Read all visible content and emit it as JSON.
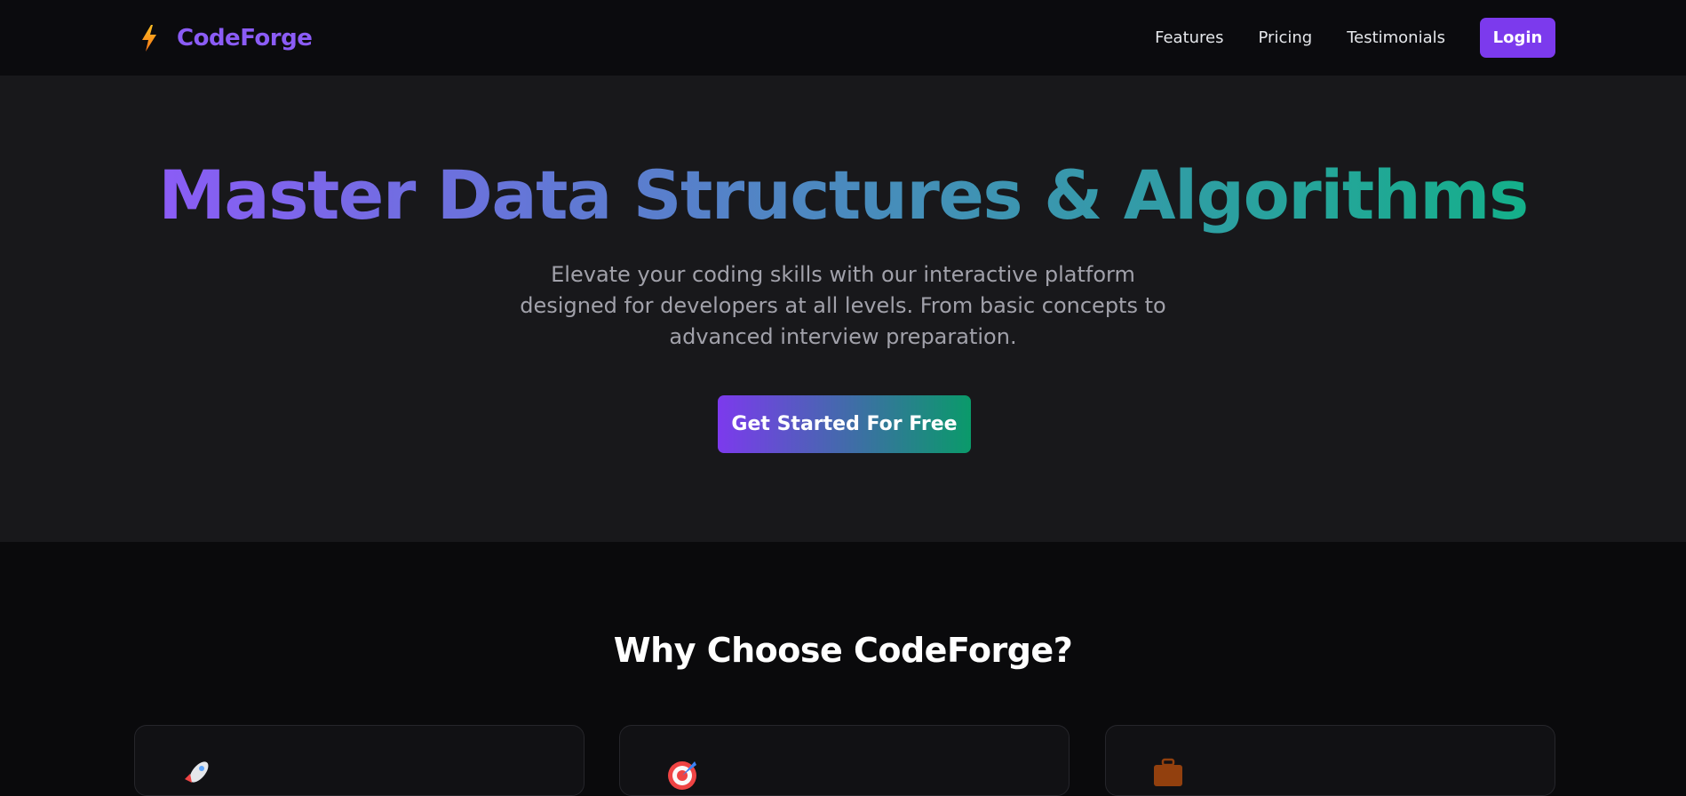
{
  "brand": {
    "name": "CodeForge",
    "icon": "lightning-bolt-icon",
    "color": "#8b5cf6"
  },
  "nav": {
    "links": [
      "Features",
      "Pricing",
      "Testimonials"
    ],
    "login_label": "Login"
  },
  "hero": {
    "title": "Master Data Structures & Algorithms",
    "subtitle": "Elevate your coding skills with our interactive platform designed for developers at all levels. From basic concepts to advanced interview preparation.",
    "cta_label": "Get Started For Free"
  },
  "features": {
    "title": "Why Choose CodeForge?",
    "cards": [
      {
        "icon": "rocket-icon"
      },
      {
        "icon": "target-icon"
      },
      {
        "icon": "briefcase-icon"
      }
    ]
  },
  "colors": {
    "accent": "#7c3aed",
    "gradient_start": "#8b5cf6",
    "gradient_end": "#10b981",
    "hero_bg": "#18181b",
    "page_bg": "#0a0a0c"
  }
}
